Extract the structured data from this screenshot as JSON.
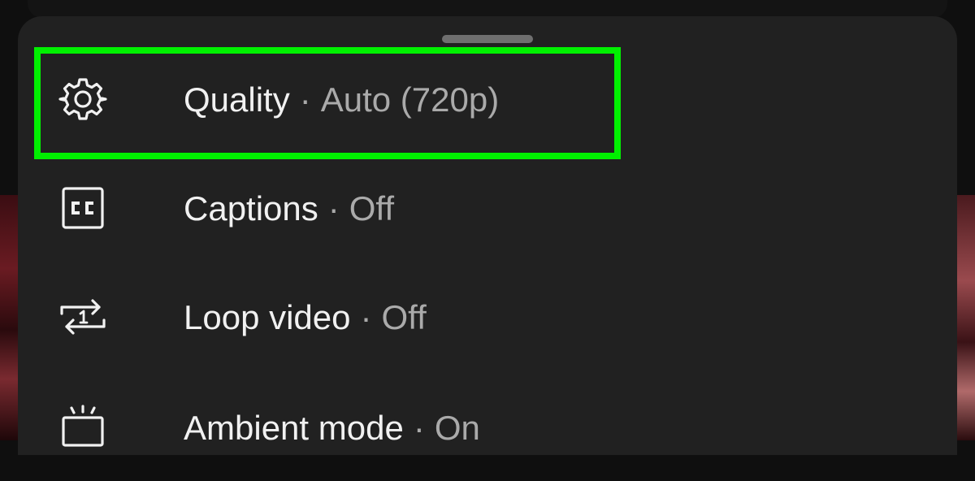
{
  "settings_sheet": {
    "items": [
      {
        "label": "Quality",
        "separator": "·",
        "value": "Auto (720p)",
        "icon": "gear-icon"
      },
      {
        "label": "Captions",
        "separator": "·",
        "value": "Off",
        "icon": "closed-captions-icon"
      },
      {
        "label": "Loop video",
        "separator": "·",
        "value": "Off",
        "icon": "repeat-one-icon"
      },
      {
        "label": "Ambient mode",
        "separator": "·",
        "value": "On",
        "icon": "ambient-mode-icon"
      }
    ]
  },
  "colors": {
    "sheet_background": "#212121",
    "label_text": "#f1f1f1",
    "value_text": "#aaaaaa",
    "highlight_outline": "#00f000"
  }
}
